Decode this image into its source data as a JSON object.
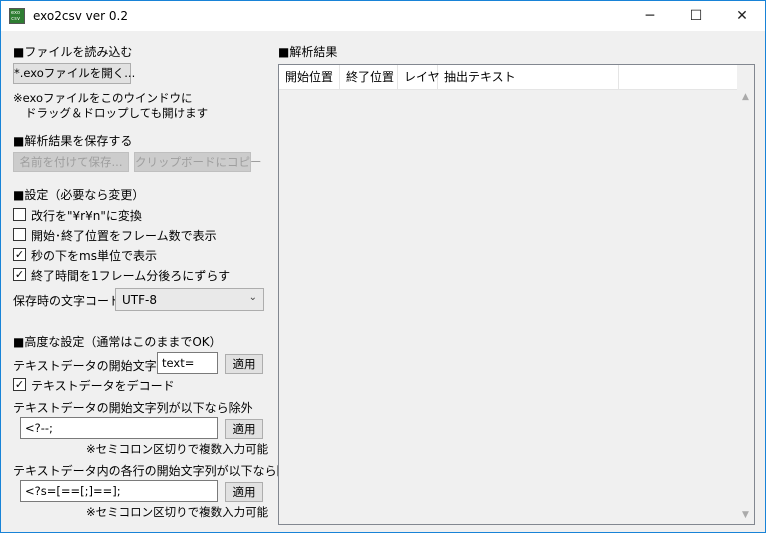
{
  "window": {
    "title": "exo2csv ver 0.2",
    "icon_text": "exo csv",
    "minimize_glyph": "─",
    "maximize_glyph": "☐",
    "close_glyph": "✕"
  },
  "load": {
    "heading": "■ファイルを読み込む",
    "open_button": "*.exoファイルを開く...",
    "drop_note_line1": "※exoファイルをこのウインドウに",
    "drop_note_line2": "ドラッグ＆ドロップしても開けます"
  },
  "save": {
    "heading": "■解析結果を保存する",
    "save_as_button": "名前を付けて保存...",
    "copy_button": "クリップボードにコピー"
  },
  "settings": {
    "heading": "■設定（必要なら変更）",
    "options": [
      {
        "label": "改行を\"¥r¥n\"に変換",
        "checked": false,
        "mark": ""
      },
      {
        "label": "開始･終了位置をフレーム数で表示",
        "checked": false,
        "mark": ""
      },
      {
        "label": "秒の下をms単位で表示",
        "checked": true,
        "mark": "✓"
      },
      {
        "label": "終了時間を1フレーム分後ろにずらす",
        "checked": true,
        "mark": "✓"
      }
    ],
    "encoding_label": "保存時の文字コード",
    "encoding_value": "UTF-8",
    "encoding_arrow": "⌄"
  },
  "advanced": {
    "heading": "■高度な設定（通常はこのままでOK）",
    "text_start_label": "テキストデータの開始文字列",
    "text_start_value": "text=",
    "apply_label": "適用",
    "decode_label": "テキストデータをデコード",
    "decode_checked": true,
    "decode_mark": "✓",
    "exclude_start_label": "テキストデータの開始文字列が以下なら除外",
    "exclude_start_value": "<?--;",
    "exclude_line_label": "テキストデータ内の各行の開始文字列が以下なら除外",
    "exclude_line_value": "<?s=[==[;]==];",
    "semicolon_note": "※セミコロン区切りで複数入力可能"
  },
  "results": {
    "heading": "■解析結果",
    "columns": [
      "開始位置",
      "終了位置",
      "レイヤ",
      "抽出テキスト"
    ],
    "scroll_up": "▲",
    "scroll_down": "▼"
  }
}
